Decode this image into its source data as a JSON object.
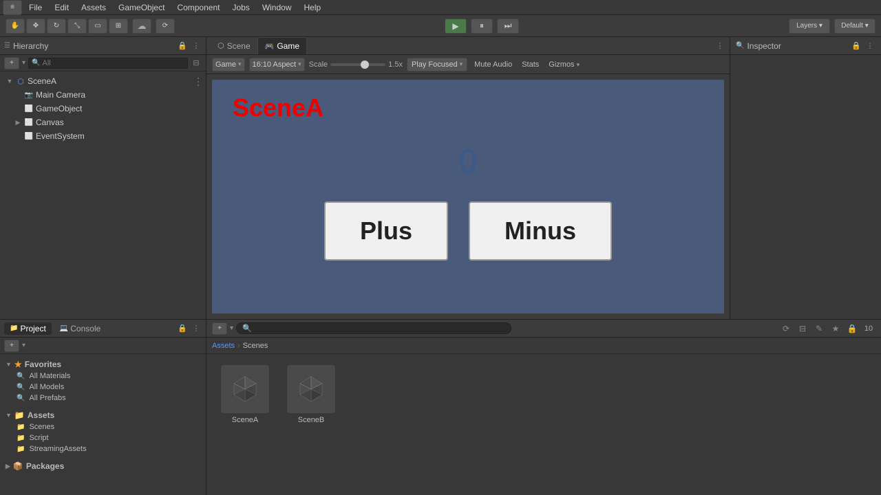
{
  "menubar": {
    "items": [
      "File",
      "Edit",
      "Assets",
      "GameObject",
      "Component",
      "Jobs",
      "Window",
      "Help"
    ]
  },
  "toolbar": {
    "play_label": "▶",
    "pause_label": "⏸",
    "step_label": "⏭"
  },
  "hierarchy": {
    "title": "Hierarchy",
    "search_placeholder": "All",
    "scene_name": "SceneA",
    "items": [
      {
        "label": "SceneA",
        "level": 0,
        "has_arrow": true,
        "icon": "🎬"
      },
      {
        "label": "Main Camera",
        "level": 1,
        "has_arrow": false,
        "icon": "📷"
      },
      {
        "label": "GameObject",
        "level": 1,
        "has_arrow": false,
        "icon": "⬜"
      },
      {
        "label": "Canvas",
        "level": 1,
        "has_arrow": true,
        "icon": "⬜"
      },
      {
        "label": "EventSystem",
        "level": 1,
        "has_arrow": false,
        "icon": "⬜"
      }
    ]
  },
  "tabs": {
    "scene_label": "Scene",
    "game_label": "Game"
  },
  "game_toolbar": {
    "display_label": "Game",
    "aspect_label": "16:10 Aspect",
    "scale_label": "Scale",
    "scale_value": "1.5x",
    "play_focused_label": "Play Focused",
    "mute_label": "Mute Audio",
    "stats_label": "Stats",
    "gizmos_label": "Gizmos"
  },
  "game_viewport": {
    "title": "SceneA",
    "counter": "0",
    "plus_btn": "Plus",
    "minus_btn": "Minus"
  },
  "inspector": {
    "title": "Inspector"
  },
  "bottom": {
    "project_tab": "Project",
    "console_tab": "Console",
    "favorites_label": "Favorites",
    "items_favorite": [
      "All Materials",
      "All Models",
      "All Prefabs"
    ],
    "assets_label": "Assets",
    "assets_items": [
      "Scenes",
      "Script",
      "StreamingAssets"
    ],
    "packages_label": "Packages"
  },
  "assets_view": {
    "breadcrumb_root": "Assets",
    "breadcrumb_sep": "›",
    "breadcrumb_child": "Scenes",
    "search_placeholder": "",
    "items": [
      {
        "name": "SceneA"
      },
      {
        "name": "SceneB"
      }
    ],
    "count_badge": "10"
  }
}
